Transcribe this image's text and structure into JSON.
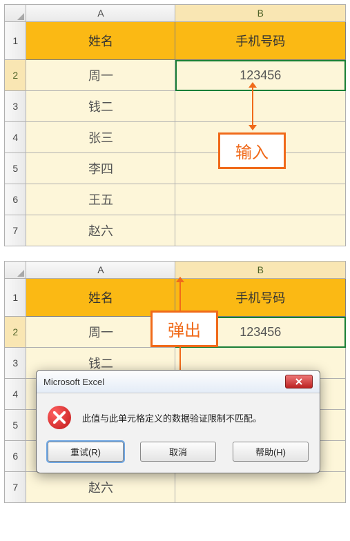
{
  "grid1": {
    "columns": [
      "A",
      "B"
    ],
    "header_row": {
      "name": "姓名",
      "phone": "手机号码"
    },
    "rows": [
      {
        "n": "1"
      },
      {
        "n": "2",
        "name": "周一",
        "phone": "123456"
      },
      {
        "n": "3",
        "name": "钱二",
        "phone": ""
      },
      {
        "n": "4",
        "name": "张三",
        "phone": ""
      },
      {
        "n": "5",
        "name": "李四",
        "phone": ""
      },
      {
        "n": "6",
        "name": "王五",
        "phone": ""
      },
      {
        "n": "7",
        "name": "赵六",
        "phone": ""
      }
    ],
    "callout": "输入",
    "selected_cell": "B2"
  },
  "grid2": {
    "columns": [
      "A",
      "B"
    ],
    "header_row": {
      "name": "姓名",
      "phone": "手机号码"
    },
    "rows": [
      {
        "n": "1"
      },
      {
        "n": "2",
        "name": "周一",
        "phone": "123456"
      },
      {
        "n": "3",
        "name": "钱二",
        "phone": ""
      },
      {
        "n": "4",
        "name": "",
        "phone": ""
      },
      {
        "n": "5",
        "name": "",
        "phone": ""
      },
      {
        "n": "6",
        "name": "",
        "phone": ""
      },
      {
        "n": "7",
        "name": "赵六",
        "phone": ""
      }
    ],
    "callout": "弹出",
    "selected_cell": "B2"
  },
  "dialog": {
    "title": "Microsoft Excel",
    "message": "此值与此单元格定义的数据验证限制不匹配。",
    "buttons": {
      "retry": "重试(R)",
      "cancel": "取消",
      "help": "帮助(H)"
    }
  }
}
